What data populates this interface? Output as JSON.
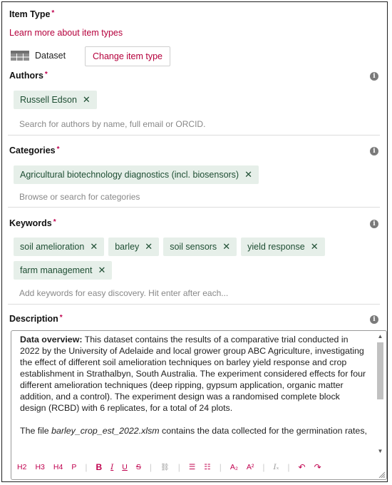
{
  "item_type": {
    "label": "Item Type",
    "required_mark": "*",
    "learn_more_link": "Learn more about item types",
    "type_name": "Dataset",
    "change_button": "Change item type"
  },
  "authors": {
    "label": "Authors",
    "required_mark": "*",
    "chips": [
      "Russell Edson"
    ],
    "placeholder": "Search for authors by name, full email or ORCID."
  },
  "categories": {
    "label": "Categories",
    "required_mark": "*",
    "chips": [
      "Agricultural biotechnology diagnostics (incl. biosensors)"
    ],
    "placeholder": "Browse or search for categories"
  },
  "keywords": {
    "label": "Keywords",
    "required_mark": "*",
    "chips_row1": [
      "soil amelioration",
      "barley",
      "soil sensors",
      "yield response"
    ],
    "chips_row2": [
      "farm management"
    ],
    "placeholder": "Add keywords for easy discovery. Hit enter after each..."
  },
  "description": {
    "label": "Description",
    "required_mark": "*",
    "para1_bold": "Data overview:",
    "para1": " This dataset contains the results of a comparative trial conducted in 2022 by the University of Adelaide and local grower group ABC Agriculture, investigating the effect of different soil amelioration techniques on barley yield response and crop establishment in Strathalbyn, South Australia. The experiment considered effects for four different amelioration techniques (deep ripping, gypsum application, organic matter addition, and a control). The experiment design was a randomised complete block design (RCBD) with 6 replicates, for a total of 24 plots.",
    "para2_start": "The file ",
    "para2_file": "barley_crop_est_2022.xlsm",
    "para2_rest": " contains the data collected for the germination rates,"
  },
  "toolbar": {
    "h2": "H2",
    "h3": "H3",
    "h4": "H4",
    "p": "P",
    "bold": "B",
    "italic": "I",
    "underline": "U",
    "strike": "S",
    "link": "🔗",
    "ul": "≔",
    "ol": "☰",
    "sub": "A₂",
    "sup": "A²",
    "clear": "Iₓ",
    "undo": "↶",
    "redo": "↷"
  },
  "icon_names": [
    "info-icon",
    "dataset-table-icon",
    "remove-chip-icon"
  ],
  "colors": {
    "accent": "#c0004e",
    "chip_bg": "#e6efe9",
    "chip_text": "#1e4e33"
  }
}
